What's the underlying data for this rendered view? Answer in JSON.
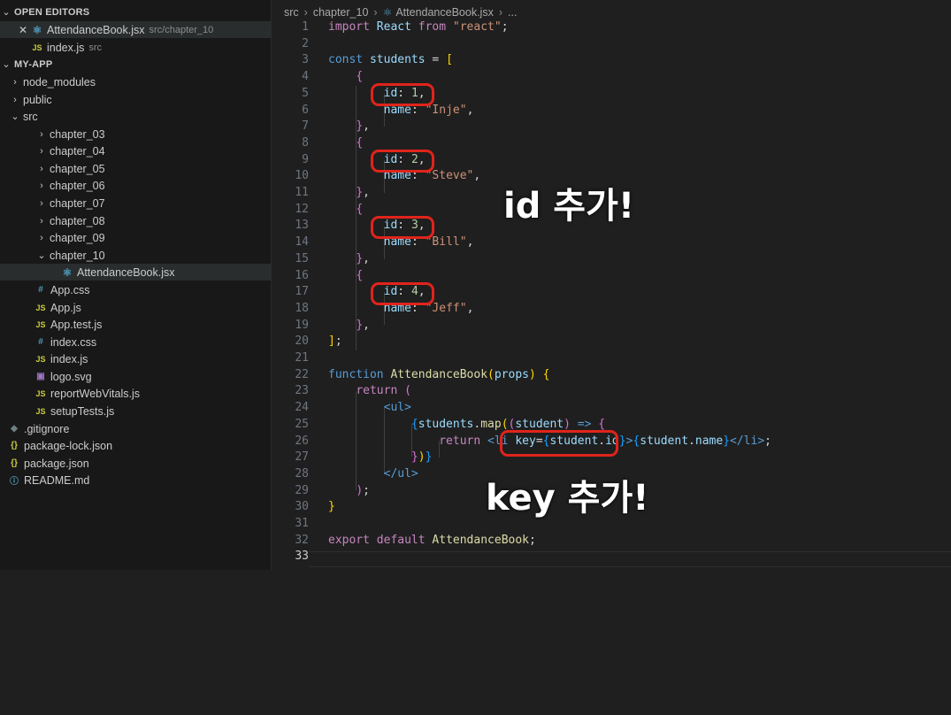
{
  "sidebar": {
    "open_editors_title": "OPEN EDITORS",
    "open_editors": [
      {
        "name": "AttendanceBook.jsx",
        "desc": "src/chapter_10"
      },
      {
        "name": "index.js",
        "desc": "src"
      }
    ],
    "project_title": "MY-APP",
    "tree": [
      "node_modules",
      "public",
      "src",
      "chapter_03",
      "chapter_04",
      "chapter_05",
      "chapter_06",
      "chapter_07",
      "chapter_08",
      "chapter_09",
      "chapter_10",
      "AttendanceBook.jsx",
      "App.css",
      "App.js",
      "App.test.js",
      "index.css",
      "index.js",
      "logo.svg",
      "reportWebVitals.js",
      "setupTests.js",
      ".gitignore",
      "package-lock.json",
      "package.json",
      "README.md"
    ]
  },
  "breadcrumb": [
    "src",
    "chapter_10",
    "AttendanceBook.jsx",
    "..."
  ],
  "line_numbers": [
    "1",
    "2",
    "3",
    "4",
    "5",
    "6",
    "7",
    "8",
    "9",
    "10",
    "11",
    "12",
    "13",
    "14",
    "15",
    "16",
    "17",
    "18",
    "19",
    "20",
    "21",
    "22",
    "23",
    "24",
    "25",
    "26",
    "27",
    "28",
    "29",
    "30",
    "31",
    "32",
    "33"
  ],
  "overlays": {
    "id_note": "id 추가!",
    "key_note": "key 추가!"
  },
  "colors": {
    "highlight": "#e0241b",
    "background": "#1f1f1f",
    "sidebar": "#181818"
  }
}
